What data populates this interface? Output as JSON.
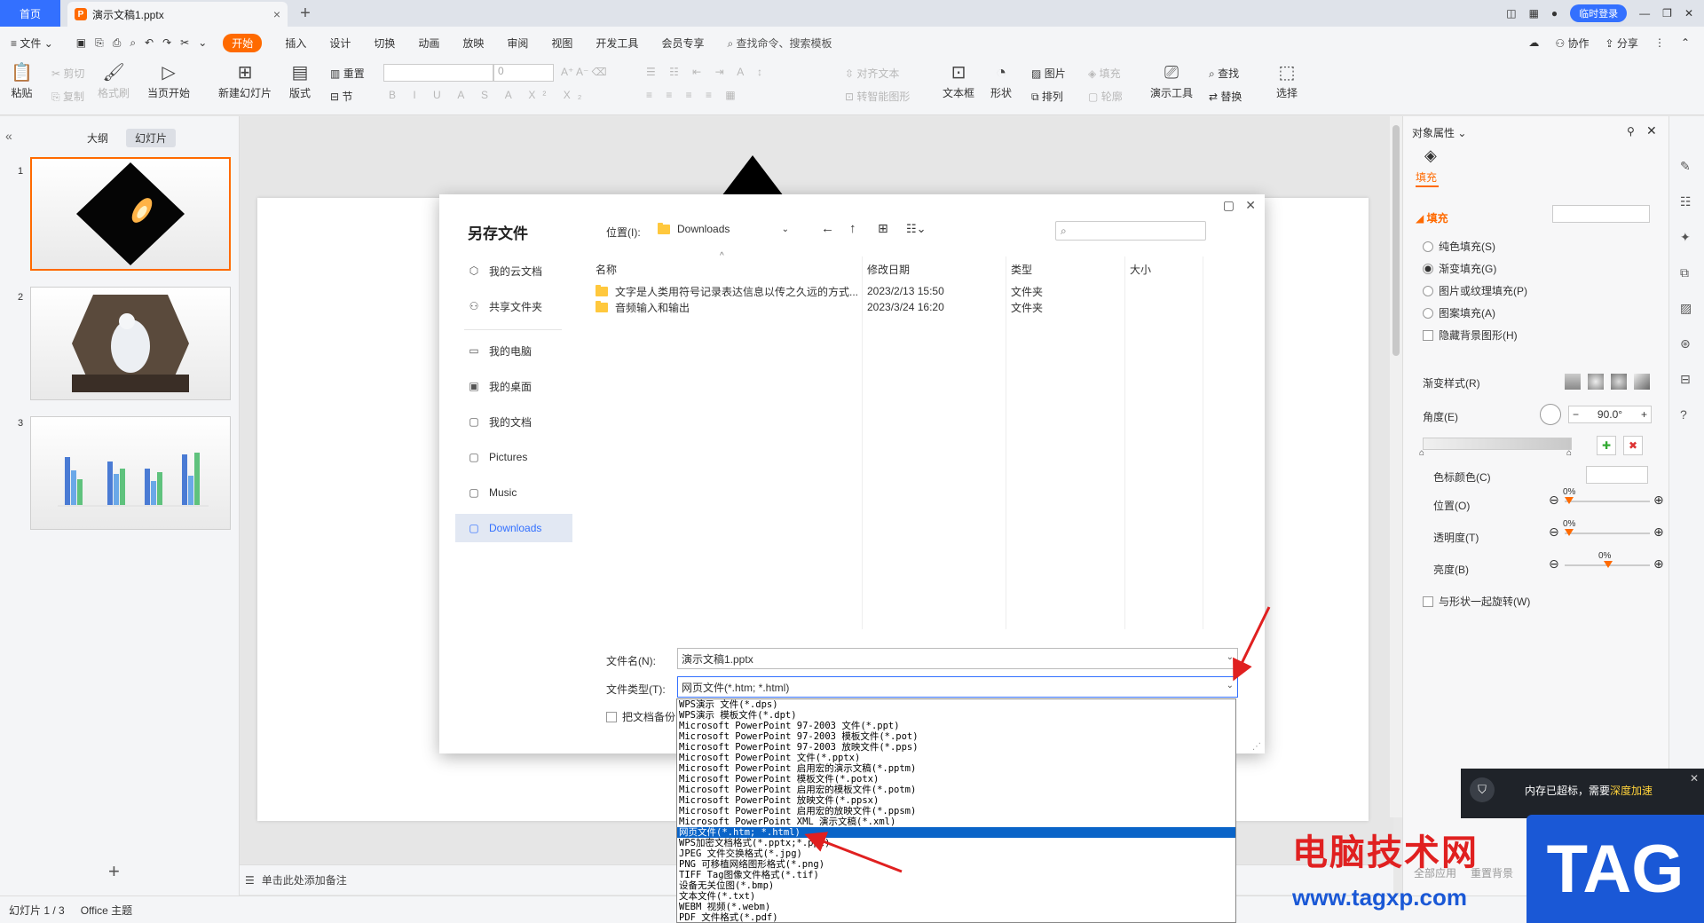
{
  "tabs": {
    "home": "首页",
    "doc_badge": "P",
    "doc_title": "演示文稿1.pptx",
    "login": "临时登录"
  },
  "menu": {
    "file": "文件",
    "items": [
      "开始",
      "插入",
      "设计",
      "切换",
      "动画",
      "放映",
      "审阅",
      "视图",
      "开发工具",
      "会员专享"
    ],
    "search": "查找命令、搜索模板",
    "collab": "协作",
    "share": "分享"
  },
  "ribbon": {
    "paste": "粘贴",
    "cut": "剪切",
    "copy": "复制",
    "format_painter": "格式刷",
    "from_start": "当页开始",
    "new_slide": "新建幻灯片",
    "layout": "版式",
    "reset": "重置",
    "section": "节",
    "font_size": "0",
    "align_text": "对齐文本",
    "convert_smartart": "转智能图形",
    "textbox": "文本框",
    "shape": "形状",
    "picture": "图片",
    "arrange": "排列",
    "fill": "填充",
    "outline": "轮廓",
    "tools": "演示工具",
    "find": "查找",
    "replace": "替换",
    "select": "选择"
  },
  "left_panel": {
    "tab_outline": "大纲",
    "tab_slides": "幻灯片",
    "slide_numbers": [
      "1",
      "2",
      "3"
    ]
  },
  "notes": "单击此处添加备注",
  "status": {
    "slide_count": "幻灯片 1 / 3",
    "theme": "Office 主题"
  },
  "right_panel": {
    "title": "对象属性",
    "tab_fill": "填充",
    "section_fill": "填充",
    "options": [
      "纯色填充(S)",
      "渐变填充(G)",
      "图片或纹理填充(P)",
      "图案填充(A)"
    ],
    "hide_bg": "隐藏背景图形(H)",
    "gradient_style": "渐变样式(R)",
    "angle": "角度(E)",
    "angle_value": "90.0°",
    "stop_color": "色标颜色(C)",
    "position": "位置(O)",
    "position_value": "0%",
    "transparency": "透明度(T)",
    "transparency_value": "0%",
    "brightness": "亮度(B)",
    "brightness_value": "0%",
    "rotate_with_shape": "与形状一起旋转(W)",
    "apply_all": "全部应用",
    "reset_bg": "重置背景"
  },
  "dialog": {
    "title": "另存文件",
    "location_label": "位置(I):",
    "location": "Downloads",
    "nav": [
      {
        "label": "我的云文档",
        "icon": "cloud-icon"
      },
      {
        "label": "共享文件夹",
        "icon": "share-folder-icon"
      },
      {
        "label": "我的电脑",
        "icon": "computer-icon"
      },
      {
        "label": "我的桌面",
        "icon": "desktop-icon"
      },
      {
        "label": "我的文档",
        "icon": "documents-icon"
      },
      {
        "label": "Pictures",
        "icon": "folder-icon"
      },
      {
        "label": "Music",
        "icon": "folder-icon"
      },
      {
        "label": "Downloads",
        "icon": "folder-icon"
      }
    ],
    "columns": [
      "名称",
      "修改日期",
      "类型",
      "大小"
    ],
    "files": [
      {
        "name": "文字是人类用符号记录表达信息以传之久远的方式...",
        "date": "2023/2/13 15:50",
        "type": "文件夹"
      },
      {
        "name": "音频输入和输出",
        "date": "2023/3/24 16:20",
        "type": "文件夹"
      }
    ],
    "filename_label": "文件名(N):",
    "filename": "演示文稿1.pptx",
    "filetype_label": "文件类型(T):",
    "filetype": "网页文件(*.htm; *.html)",
    "backup_label": "把文档备份"
  },
  "filetype_options": [
    "WPS演示 文件(*.dps)",
    "WPS演示 模板文件(*.dpt)",
    "Microsoft PowerPoint 97-2003 文件(*.ppt)",
    "Microsoft PowerPoint 97-2003 模板文件(*.pot)",
    "Microsoft PowerPoint 97-2003 放映文件(*.pps)",
    "Microsoft PowerPoint 文件(*.pptx)",
    "Microsoft PowerPoint 启用宏的演示文稿(*.pptm)",
    "Microsoft PowerPoint 模板文件(*.potx)",
    "Microsoft PowerPoint 启用宏的模板文件(*.potm)",
    "Microsoft PowerPoint 放映文件(*.ppsx)",
    "Microsoft PowerPoint 启用宏的放映文件(*.ppsm)",
    "Microsoft PowerPoint XML 演示文稿(*.xml)",
    "网页文件(*.htm; *.html)",
    "WPS加密文档格式(*.pptx;*.ppt)",
    "JPEG 文件交换格式(*.jpg)",
    "PNG 可移植网络图形格式(*.png)",
    "TIFF Tag图像文件格式(*.tif)",
    "设备无关位图(*.bmp)",
    "文本文件(*.txt)",
    "WEBM 视频(*.webm)",
    "PDF 文件格式(*.pdf)"
  ],
  "selected_filetype_index": 12,
  "notification": {
    "text": "内存已超标，需要",
    "action": "深度加速"
  },
  "watermark": {
    "cn": "电脑技术网",
    "url": "www.tagxp.com",
    "tag": "TAG"
  },
  "colors": {
    "accent_orange": "#ff6a00",
    "accent_blue": "#3370ff",
    "arrow_red": "#e02020",
    "list_selection": "#0a64c8"
  }
}
